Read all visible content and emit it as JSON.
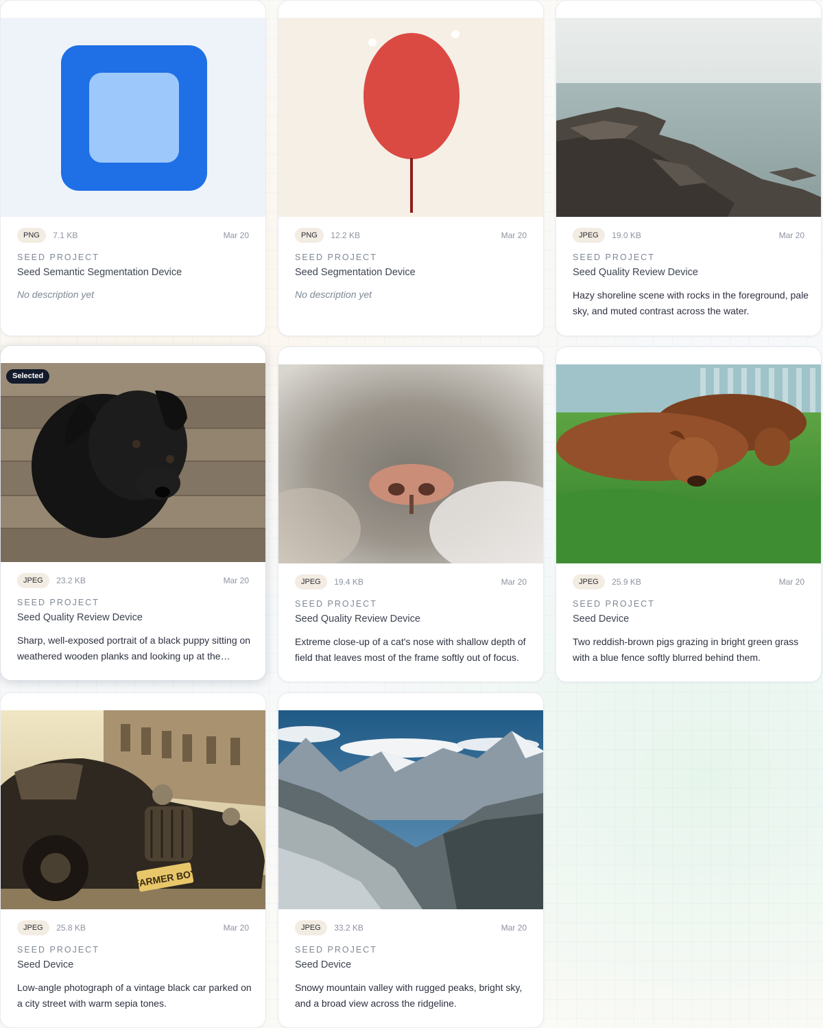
{
  "cards": [
    {
      "type": "PNG",
      "size": "7.1 KB",
      "date": "Mar 20",
      "project": "Seed Project",
      "device": "Seed Semantic Segmentation Device",
      "description": "No description yet",
      "thumb": "blue-rounded-square-icon"
    },
    {
      "type": "PNG",
      "size": "12.2 KB",
      "date": "Mar 20",
      "project": "Seed Project",
      "device": "Seed Segmentation Device",
      "description": "No description yet",
      "thumb": "red-balloon-illustration"
    },
    {
      "type": "JPEG",
      "size": "19.0 KB",
      "date": "Mar 20",
      "project": "Seed Project",
      "device": "Seed Quality Review Device",
      "description": "Hazy shoreline scene with rocks in the foreground, pale sky, and muted contrast across the water.",
      "thumb": "rocky-shoreline-photo"
    },
    {
      "type": "JPEG",
      "size": "23.2 KB",
      "date": "Mar 20",
      "project": "Seed Project",
      "device": "Seed Quality Review Device",
      "description": "Sharp, well-exposed portrait of a black puppy sitting on weathered wooden planks and looking up at the camera.",
      "thumb": "black-puppy-photo",
      "selected": true,
      "selected_label": "Selected"
    },
    {
      "type": "JPEG",
      "size": "19.4 KB",
      "date": "Mar 20",
      "project": "Seed Project",
      "device": "Seed Quality Review Device",
      "description": "Extreme close-up of a cat's nose with shallow depth of field that leaves most of the frame softly out of focus.",
      "thumb": "cat-nose-photo"
    },
    {
      "type": "JPEG",
      "size": "25.9 KB",
      "date": "Mar 20",
      "project": "Seed Project",
      "device": "Seed Device",
      "description": "Two reddish-brown pigs grazing in bright green grass with a blue fence softly blurred behind them.",
      "thumb": "pigs-grazing-photo"
    },
    {
      "type": "JPEG",
      "size": "25.8 KB",
      "date": "Mar 20",
      "project": "Seed Project",
      "device": "Seed Device",
      "description": "Low-angle photograph of a vintage black car parked on a city street with warm sepia tones.",
      "thumb": "vintage-car-photo",
      "plate": "FARMER BOY"
    },
    {
      "type": "JPEG",
      "size": "33.2 KB",
      "date": "Mar 20",
      "project": "Seed Project",
      "device": "Seed Device",
      "description": "Snowy mountain valley with rugged peaks, bright sky, and a broad view across the ridgeline.",
      "thumb": "mountain-valley-photo"
    }
  ],
  "colors": {
    "badge_bg": "#f3ece2",
    "selected_badge_bg": "#121a2b",
    "muted": "#8d93a0",
    "text": "#2d3140"
  }
}
